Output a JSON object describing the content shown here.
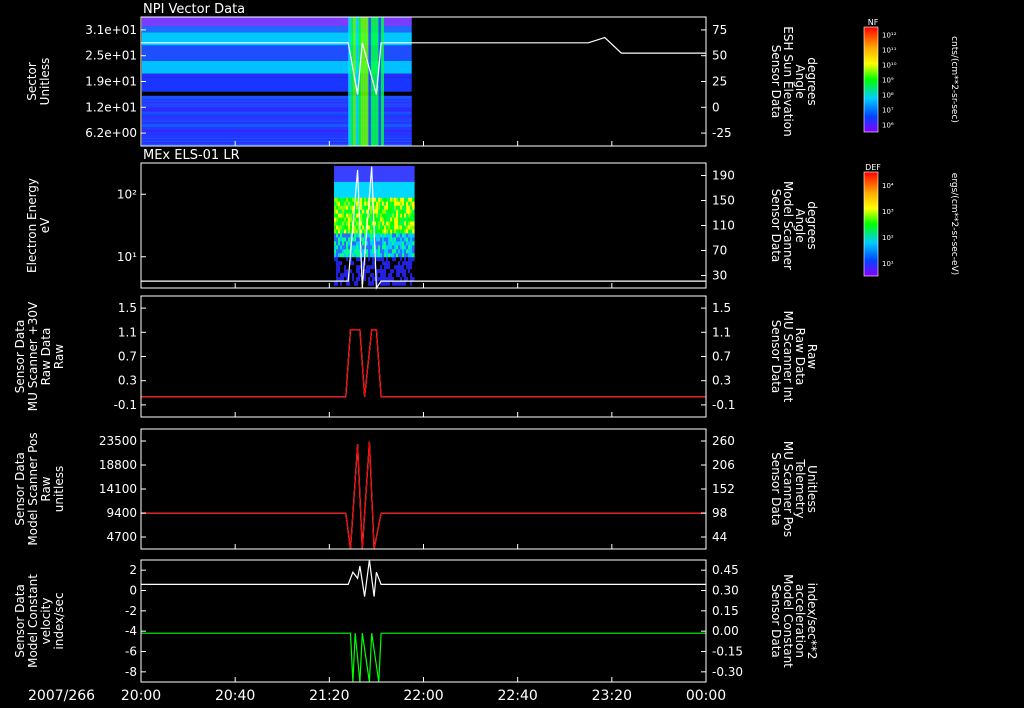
{
  "date_label": "2007/266",
  "time_ticks": [
    "20:00",
    "20:40",
    "21:20",
    "22:00",
    "22:40",
    "23:20",
    "00:00"
  ],
  "colors": {
    "white": "#ffffff",
    "red": "#ff0000",
    "green": "#00ff00",
    "background": "#000000"
  },
  "chart_data": [
    {
      "type": "heatmap",
      "title": "NPI Vector Data",
      "left_ylabel": [
        "Sector",
        "Unitless"
      ],
      "left_ticks": [
        "3.1e+01",
        "2.5e+01",
        "1.9e+01",
        "1.2e+01",
        "6.2e+00"
      ],
      "right_ylabel": [
        "Sensor Data",
        "ESH Sun Elevation",
        "Angle",
        "degrees"
      ],
      "right_ticks": [
        "75",
        "50",
        "25",
        "0",
        "-25"
      ],
      "right_ylim": [
        -50,
        75
      ],
      "overlay_line": {
        "x": [
          "20:00",
          "21:28",
          "21:32",
          "21:34",
          "21:40",
          "21:42",
          "23:10",
          "23:17",
          "23:24",
          "00:00"
        ],
        "y": [
          50,
          50,
          0,
          50,
          0,
          50,
          50,
          55,
          40,
          40
        ]
      },
      "colorbar": {
        "label": "NF",
        "units": "cnts/(cm**2-sr-sec)",
        "ticks": [
          "10¹²",
          "10¹¹",
          "10¹⁰",
          "10⁹",
          "10⁸",
          "10⁷",
          "10⁶"
        ]
      }
    },
    {
      "type": "heatmap",
      "title": "MEx ELS-01 LR",
      "left_ylabel": [
        "Electron Energy",
        "eV"
      ],
      "left_ticks": [
        "10²",
        "10¹"
      ],
      "right_ylabel": [
        "Sensor Data",
        "Model Scanner",
        "Angle",
        "degrees"
      ],
      "right_ticks": [
        "190",
        "150",
        "110",
        "70",
        "30"
      ],
      "right_ylim": [
        10,
        190
      ],
      "overlay_line": {
        "x": [
          "20:00",
          "21:28",
          "21:32",
          "21:34",
          "21:38",
          "21:40",
          "21:42",
          "00:00"
        ],
        "y": [
          20,
          20,
          180,
          10,
          185,
          10,
          20,
          20
        ]
      },
      "colorbar": {
        "label": "DEF",
        "units": "ergs/(cm**2-sr-sec-eV)",
        "ticks": [
          "10⁴",
          "10³",
          "10²",
          "10¹"
        ]
      }
    },
    {
      "type": "line",
      "left_ylabel": [
        "Sensor Data",
        "MU Scanner +30V",
        "Raw Data",
        "Raw"
      ],
      "left_ticks": [
        "1.5",
        "1.1",
        "0.7",
        "0.3",
        "-0.1"
      ],
      "left_ylim": [
        -0.3,
        1.5
      ],
      "right_ylabel": [
        "Sensor Data",
        "MU Scanner Int",
        "Raw Data",
        "Raw"
      ],
      "right_ticks": [
        "1.5",
        "1.1",
        "0.7",
        "0.3",
        "-0.1"
      ],
      "series": [
        {
          "axis": "left",
          "color": "white",
          "x": [
            "20:00",
            "21:27",
            "21:29",
            "21:33",
            "21:35",
            "21:38",
            "21:40",
            "21:42",
            "00:00"
          ],
          "y": [
            0,
            0,
            1,
            1,
            0,
            1,
            1,
            0,
            0
          ]
        },
        {
          "axis": "left",
          "color": "red",
          "x": [
            "20:00",
            "21:27",
            "21:29",
            "21:33",
            "21:35",
            "21:38",
            "21:40",
            "21:42",
            "00:00"
          ],
          "y": [
            0,
            0,
            1,
            1,
            0,
            1,
            1,
            0,
            0
          ]
        }
      ]
    },
    {
      "type": "line",
      "left_ylabel": [
        "Sensor Data",
        "Model Scanner Pos",
        "Raw",
        "unitless"
      ],
      "left_ticks": [
        "23500",
        "18800",
        "14100",
        "9400",
        "4700"
      ],
      "left_ylim": [
        0,
        23500
      ],
      "right_ylabel": [
        "Sensor Data",
        "MU Scanner Pos",
        "Telemetry",
        "Unitless"
      ],
      "right_ticks": [
        "260",
        "206",
        "152",
        "98",
        "44"
      ],
      "series": [
        {
          "axis": "left",
          "color": "white",
          "x": [
            "20:00",
            "21:27",
            "21:29",
            "21:32",
            "21:34",
            "21:37",
            "21:39",
            "21:42",
            "00:00"
          ],
          "y": [
            7000,
            7000,
            0,
            20500,
            0,
            21000,
            0,
            7000,
            7000
          ]
        },
        {
          "axis": "left",
          "color": "red",
          "x": [
            "20:00",
            "21:27",
            "21:29",
            "21:32",
            "21:34",
            "21:37",
            "21:39",
            "21:42",
            "00:00"
          ],
          "y": [
            7000,
            7000,
            0,
            20500,
            0,
            21000,
            0,
            7000,
            7000
          ]
        }
      ]
    },
    {
      "type": "line",
      "left_ylabel": [
        "Sensor Data",
        "Model Constant",
        "velocity",
        "index/sec"
      ],
      "left_ticks": [
        "2",
        "0",
        "-2",
        "-4",
        "-6",
        "-8"
      ],
      "left_ylim": [
        -8,
        2
      ],
      "right_ylabel": [
        "Sensor Data",
        "Model Constant",
        "acceleration",
        "index/sec**2"
      ],
      "right_ticks": [
        "0.45",
        "0.30",
        "0.15",
        "0.00",
        "-0.15",
        "-0.30"
      ],
      "right_ylim": [
        -0.3,
        0.45
      ],
      "series": [
        {
          "axis": "left",
          "color": "white",
          "x": [
            "20:00",
            "21:28",
            "21:30",
            "21:32",
            "21:33",
            "21:35",
            "21:37",
            "21:39",
            "21:40",
            "21:42",
            "00:00"
          ],
          "y": [
            0,
            0,
            1,
            0.5,
            1.5,
            -1,
            2,
            -1,
            1,
            0,
            0
          ]
        },
        {
          "axis": "right",
          "color": "green",
          "x": [
            "20:00",
            "21:29",
            "21:30",
            "21:31",
            "21:33",
            "21:34",
            "21:37",
            "21:38",
            "21:41",
            "21:42",
            "00:00"
          ],
          "y": [
            0,
            0,
            -0.3,
            0,
            -0.3,
            0,
            -0.3,
            0,
            -0.3,
            0,
            0
          ]
        }
      ]
    }
  ]
}
